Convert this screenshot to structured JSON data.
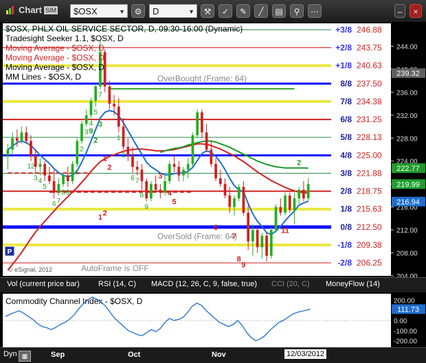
{
  "window": {
    "app_title": "Chart",
    "symbol_value": "$OSX",
    "interval_value": "D",
    "tb_icons": [
      "gear-icon",
      "tools-icon",
      "check-icon",
      "eraser-icon",
      "line-tool-icon",
      "news-icon",
      "pin-icon",
      "more-icon"
    ]
  },
  "chart_data": {
    "type": "candlestick",
    "legend": [
      "$OSX, PHLX OIL SERVICE SECTOR, D, 09:30-16:00 (Dynamic)",
      "Tradesight Seeker 1.1, $OSX, D",
      "Moving Average - $OSX, D",
      "Moving Average - $OSX, D",
      "Moving Average - $OSX, D",
      "MM Lines - $OSX, D"
    ],
    "ylim": [
      204,
      248
    ],
    "y_ticks": [
      204,
      208,
      212,
      216,
      220,
      224,
      228,
      232,
      236,
      240,
      244
    ],
    "x_labels": [
      "Sep",
      "Oct",
      "Nov",
      "12/03/2012"
    ],
    "price_tags": [
      {
        "value": 239.32,
        "label": "239.32",
        "color": "#606060"
      },
      {
        "value": 222.77,
        "label": "222.77",
        "color": "#1f9a2a"
      },
      {
        "value": 219.99,
        "label": "219.99",
        "color": "#1fa030"
      },
      {
        "value": 216.94,
        "label": "216.94",
        "color": "#1e6ed0"
      }
    ],
    "murrey_lines": [
      {
        "label": "+3/8",
        "value": 246.88,
        "color": "#2a8a4a",
        "width": 1,
        "label_color": "#3030ff"
      },
      {
        "label": "+2/8",
        "value": 243.75,
        "color": "#d02020",
        "width": 1,
        "label_color": "#3030ff"
      },
      {
        "label": "+1/8",
        "value": 240.63,
        "color": "#e8e840",
        "width": 4,
        "label_color": "#3030ff"
      },
      {
        "label": "8/8",
        "value": 237.5,
        "color": "#1010ff",
        "width": 3,
        "label_color": "#2020a0"
      },
      {
        "label": "7/8",
        "value": 234.38,
        "color": "#e8e840",
        "width": 4,
        "label_color": "#2020a0"
      },
      {
        "label": "6/8",
        "value": 231.25,
        "color": "#d02020",
        "width": 2,
        "label_color": "#2020a0"
      },
      {
        "label": "5/8",
        "value": 228.13,
        "color": "#2a8a4a",
        "width": 1,
        "label_color": "#2020a0"
      },
      {
        "label": "4/8",
        "value": 225.0,
        "color": "#1010ff",
        "width": 3,
        "label_color": "#2020a0"
      },
      {
        "label": "3/8",
        "value": 221.88,
        "color": "#2a8a4a",
        "width": 1,
        "label_color": "#2020a0"
      },
      {
        "label": "2/8",
        "value": 218.75,
        "color": "#d02020",
        "width": 2,
        "label_color": "#2020a0"
      },
      {
        "label": "1/8",
        "value": 215.63,
        "color": "#e8e840",
        "width": 4,
        "label_color": "#2020a0"
      },
      {
        "label": "0/8",
        "value": 212.5,
        "color": "#1010ff",
        "width": 5,
        "label_color": "#2020a0"
      },
      {
        "label": "-1/8",
        "value": 209.38,
        "color": "#e8e840",
        "width": 4,
        "label_color": "#3030ff"
      },
      {
        "label": "-2/8",
        "value": 206.25,
        "color": "#d02020",
        "width": 1,
        "label_color": "#3030ff"
      }
    ],
    "annotations": [
      {
        "text": "OverBought (Frame: 64)",
        "value": 238.4
      },
      {
        "text": "OverSold (Frame: 64)",
        "value": 210.9
      },
      {
        "text": "AutoFrame is OFF",
        "value": 205.3
      }
    ],
    "copyright": "© eSignal, 2012",
    "candles": [
      {
        "o": 225,
        "h": 227,
        "l": 222.5,
        "c": 226,
        "n": ""
      },
      {
        "o": 226,
        "h": 229,
        "l": 225,
        "c": 228,
        "n": ""
      },
      {
        "o": 228,
        "h": 229.5,
        "l": 226.5,
        "c": 227.5,
        "n": ""
      },
      {
        "o": 227.5,
        "h": 230,
        "l": 227,
        "c": 229,
        "n": ""
      },
      {
        "o": 229,
        "h": 230,
        "l": 227,
        "c": 227.5,
        "n": ""
      },
      {
        "o": 227.5,
        "h": 228.5,
        "l": 224,
        "c": 225,
        "n": "12"
      },
      {
        "o": 225,
        "h": 226,
        "l": 222,
        "c": 223,
        "n": "3"
      },
      {
        "o": 223,
        "h": 224.5,
        "l": 221.5,
        "c": 223.5,
        "n": "4"
      },
      {
        "o": 223.5,
        "h": 224,
        "l": 220.5,
        "c": 221.5,
        "n": "5"
      },
      {
        "o": 221.5,
        "h": 223,
        "l": 220,
        "c": 220.5,
        "n": ""
      },
      {
        "o": 220.5,
        "h": 222.5,
        "l": 217.5,
        "c": 218.5,
        "n": "6"
      },
      {
        "o": 218.5,
        "h": 221,
        "l": 218,
        "c": 220,
        "n": "7"
      },
      {
        "o": 220,
        "h": 222,
        "l": 219.5,
        "c": 221.5,
        "n": "8"
      },
      {
        "o": 221.5,
        "h": 223,
        "l": 219.5,
        "c": 220.5,
        "n": "9"
      },
      {
        "o": 220.5,
        "h": 224,
        "l": 220,
        "c": 223.5,
        "n": ""
      },
      {
        "o": 223.5,
        "h": 228,
        "l": 223,
        "c": 227.5,
        "n": "1"
      },
      {
        "o": 227.5,
        "h": 231,
        "l": 227,
        "c": 230.5,
        "n": "2"
      },
      {
        "o": 230.5,
        "h": 233,
        "l": 230,
        "c": 232,
        "n": "3"
      },
      {
        "o": 232,
        "h": 235,
        "l": 231.5,
        "c": 234.5,
        "n": "4"
      },
      {
        "o": 234.5,
        "h": 237.5,
        "l": 233.5,
        "c": 237,
        "n": "5"
      },
      {
        "o": 237,
        "h": 245,
        "l": 236.5,
        "c": 243,
        "n": "7"
      },
      {
        "o": 243,
        "h": 243.5,
        "l": 236,
        "c": 237,
        "n": ""
      },
      {
        "o": 237,
        "h": 238,
        "l": 233,
        "c": 234,
        "n": ""
      },
      {
        "o": 234,
        "h": 235.5,
        "l": 232,
        "c": 233.5,
        "n": ""
      },
      {
        "o": 233.5,
        "h": 235,
        "l": 229,
        "c": 230,
        "n": "1"
      },
      {
        "o": 230,
        "h": 231.5,
        "l": 226,
        "c": 226.5,
        "n": "2"
      },
      {
        "o": 226.5,
        "h": 228,
        "l": 224,
        "c": 225,
        "n": ""
      },
      {
        "o": 225,
        "h": 226.5,
        "l": 222,
        "c": 223,
        "n": "6"
      },
      {
        "o": 223,
        "h": 224,
        "l": 221.5,
        "c": 222.5,
        "n": "7"
      },
      {
        "o": 222.5,
        "h": 223.5,
        "l": 219,
        "c": 220.5,
        "n": "8"
      },
      {
        "o": 220.5,
        "h": 221,
        "l": 217,
        "c": 217.5,
        "n": "9"
      },
      {
        "o": 217.5,
        "h": 220.5,
        "l": 217,
        "c": 220,
        "n": ""
      },
      {
        "o": 220,
        "h": 221.5,
        "l": 218.5,
        "c": 219,
        "n": ""
      },
      {
        "o": 219,
        "h": 220,
        "l": 217.5,
        "c": 218.5,
        "n": ""
      },
      {
        "o": 218.5,
        "h": 221.5,
        "l": 218,
        "c": 220.5,
        "n": ""
      },
      {
        "o": 220.5,
        "h": 224,
        "l": 220,
        "c": 223.5,
        "n": ""
      },
      {
        "o": 223.5,
        "h": 225,
        "l": 222,
        "c": 223,
        "n": ""
      },
      {
        "o": 223,
        "h": 224,
        "l": 220.5,
        "c": 221.5,
        "n": ""
      },
      {
        "o": 221.5,
        "h": 223,
        "l": 220.5,
        "c": 222.5,
        "n": ""
      },
      {
        "o": 222.5,
        "h": 224.5,
        "l": 221,
        "c": 223.5,
        "n": ""
      },
      {
        "o": 223.5,
        "h": 229,
        "l": 223,
        "c": 228.5,
        "n": ""
      },
      {
        "o": 228.5,
        "h": 233,
        "l": 228,
        "c": 232.5,
        "n": ""
      },
      {
        "o": 232.5,
        "h": 233,
        "l": 228,
        "c": 229,
        "n": ""
      },
      {
        "o": 229,
        "h": 230.5,
        "l": 225.5,
        "c": 226,
        "n": ""
      },
      {
        "o": 226,
        "h": 227.5,
        "l": 223,
        "c": 223.5,
        "n": ""
      },
      {
        "o": 223.5,
        "h": 224.5,
        "l": 220.5,
        "c": 221,
        "n": ""
      },
      {
        "o": 221,
        "h": 222.5,
        "l": 219.5,
        "c": 220,
        "n": ""
      },
      {
        "o": 220,
        "h": 221,
        "l": 217.5,
        "c": 218,
        "n": ""
      },
      {
        "o": 218,
        "h": 219.5,
        "l": 215,
        "c": 216,
        "n": ""
      },
      {
        "o": 216,
        "h": 218,
        "l": 214.5,
        "c": 217.5,
        "n": ""
      },
      {
        "o": 217.5,
        "h": 220,
        "l": 217,
        "c": 219.5,
        "n": ""
      },
      {
        "o": 219.5,
        "h": 220.5,
        "l": 214.5,
        "c": 215,
        "n": ""
      },
      {
        "o": 215,
        "h": 216.5,
        "l": 208.5,
        "c": 210,
        "n": ""
      },
      {
        "o": 210,
        "h": 213,
        "l": 207.5,
        "c": 212,
        "n": ""
      },
      {
        "o": 212,
        "h": 212.5,
        "l": 208,
        "c": 209,
        "n": ""
      },
      {
        "o": 209,
        "h": 211.5,
        "l": 207,
        "c": 211,
        "n": ""
      },
      {
        "o": 211,
        "h": 211.5,
        "l": 206.5,
        "c": 207.5,
        "n": ""
      },
      {
        "o": 207.5,
        "h": 212.5,
        "l": 207,
        "c": 212,
        "n": ""
      },
      {
        "o": 212,
        "h": 216.5,
        "l": 211.5,
        "c": 216,
        "n": ""
      },
      {
        "o": 216,
        "h": 217.5,
        "l": 214.5,
        "c": 215,
        "n": ""
      },
      {
        "o": 215,
        "h": 218.5,
        "l": 214.5,
        "c": 218,
        "n": ""
      },
      {
        "o": 218,
        "h": 218.5,
        "l": 215,
        "c": 215.5,
        "n": ""
      },
      {
        "o": 215.5,
        "h": 218.5,
        "l": 213,
        "c": 217.5,
        "n": ""
      },
      {
        "o": 217.5,
        "h": 219.5,
        "l": 216.5,
        "c": 219,
        "n": ""
      },
      {
        "o": 219,
        "h": 220.5,
        "l": 217,
        "c": 217.5,
        "n": ""
      },
      {
        "o": 217.5,
        "h": 221,
        "l": 217,
        "c": 220,
        "n": ""
      }
    ],
    "blue_ma": [
      226,
      226.6,
      227.2,
      227.5,
      227.2,
      226.7,
      225.9,
      225,
      224.3,
      223.6,
      222.7,
      222,
      221.5,
      221.3,
      221.5,
      222.3,
      223.8,
      225.5,
      227.5,
      229.5,
      231.5,
      232.5,
      232.8,
      232.6,
      231.9,
      230.7,
      229.3,
      227.9,
      226.5,
      225.2,
      223.8,
      223,
      222.5,
      221.9,
      221.6,
      221.6,
      221.8,
      221.9,
      222,
      222.2,
      222.9,
      224.1,
      225.3,
      225.8,
      225.5,
      224.8,
      223.8,
      222.5,
      221,
      219.7,
      219,
      218.6,
      216.6,
      214.8,
      213.5,
      212.6,
      211.5,
      211.2,
      211.8,
      212.6,
      213.6,
      214.5,
      215.3,
      216.3,
      216.7,
      217
    ],
    "red_ma": [
      205,
      206,
      207,
      208.1,
      209.3,
      210.5,
      211.6,
      212.6,
      213.5,
      214.4,
      215.3,
      216.2,
      217,
      217.8,
      218.6,
      219.4,
      220.3,
      221.2,
      222.2,
      223.1,
      223.9,
      224.4,
      224.8,
      225.1,
      225.4,
      225.7,
      225.9,
      226,
      226.1,
      226.1,
      226,
      225.9,
      225.8,
      225.8,
      225.8,
      225.9,
      226,
      226.2,
      226.4,
      226.6,
      226.8,
      227,
      227,
      226.9,
      226.7,
      226.4,
      226.1,
      225.7,
      225.3,
      224.9,
      224.4,
      223.9,
      223.3,
      222.7,
      222.1,
      221.6,
      221.1,
      220.6,
      220.2,
      219.8,
      219.4,
      219.1,
      218.8,
      218.6,
      218.5,
      218.4
    ],
    "green_ma_start": 33,
    "green_ma": [
      225.5,
      225.8,
      226,
      226.2,
      226.3,
      226.5,
      226.8,
      227,
      227.2,
      227.4,
      227.5,
      227.5,
      227.3,
      227,
      226.7,
      226.4,
      226,
      225.6,
      225.2,
      224.8,
      224.4,
      224,
      223.7,
      223.4,
      223.2,
      223,
      222.9,
      222.8,
      222.8,
      222.8,
      222.8,
      222.8,
      222.77
    ],
    "green_seg": {
      "from": 22,
      "to": 62,
      "value": 236.6
    },
    "red_dash": [
      {
        "from": 0,
        "to": 18,
        "value": 221.9
      },
      {
        "from": 9,
        "to": 40,
        "value": 218.6
      }
    ],
    "numbers": [
      {
        "t": "9",
        "i": 18,
        "v": 228.8,
        "c": "#20a020"
      },
      {
        "t": "2",
        "i": 19,
        "v": 227.2,
        "c": "#20a020"
      },
      {
        "t": "3",
        "i": 20,
        "v": 230.0,
        "c": "#20a020"
      },
      {
        "t": "1",
        "i": 21,
        "v": 224.0,
        "c": "#d02020"
      },
      {
        "t": "2",
        "i": 22,
        "v": 222.5,
        "c": "#d02020"
      },
      {
        "t": "1",
        "i": 20,
        "v": 213.8,
        "c": "#d02020"
      },
      {
        "t": "2",
        "i": 21,
        "v": 214.5,
        "c": "#d02020"
      },
      {
        "t": "3",
        "i": 33,
        "v": 221.0,
        "c": "#d02020"
      },
      {
        "t": "4",
        "i": 35,
        "v": 218.0,
        "c": "#d02020"
      },
      {
        "t": "5",
        "i": 36,
        "v": 216.5,
        "c": "#d02020"
      },
      {
        "t": "6",
        "i": 45,
        "v": 212.0,
        "c": "#d02020"
      },
      {
        "t": "7",
        "i": 49,
        "v": 210.5,
        "c": "#d02020"
      },
      {
        "t": "8",
        "i": 50,
        "v": 206.5,
        "c": "#d02020"
      },
      {
        "t": "9",
        "i": 51,
        "v": 205.5,
        "c": "#d02020"
      },
      {
        "t": "11",
        "i": 60,
        "v": 211.5,
        "c": "#d02020"
      },
      {
        "t": "2",
        "i": 63,
        "v": 223.3,
        "c": "#20a020"
      }
    ]
  },
  "indicator_tabs": [
    "Vol (current price bar)",
    "RSI (14, C)",
    "MACD (12, 26, C, 9, false, true)",
    "CCI (20, C)",
    "MoneyFlow (14)"
  ],
  "cci": {
    "title": "Commodity Channel Index - $OSX, D",
    "last_label": "111.73",
    "ylim": [
      -250,
      250
    ],
    "y_ticks": [
      200,
      100,
      0,
      -100,
      -200
    ],
    "y_tick_labels": [
      "200.00",
      "100.00",
      "0.00",
      "-100.00",
      "-200.00"
    ],
    "values": [
      40,
      60,
      80,
      95,
      70,
      40,
      10,
      -30,
      -60,
      -70,
      -90,
      -70,
      -40,
      -20,
      10,
      50,
      110,
      160,
      200,
      230,
      210,
      180,
      140,
      80,
      20,
      -20,
      -60,
      -100,
      -120,
      -140,
      -150,
      -120,
      -90,
      -110,
      -80,
      -20,
      20,
      0,
      10,
      30,
      80,
      140,
      170,
      150,
      100,
      60,
      20,
      -20,
      -40,
      -60,
      -40,
      0,
      -50,
      -120,
      -170,
      -200,
      -180,
      -150,
      -100,
      -60,
      -20,
      0,
      30,
      60,
      80,
      90,
      100,
      111.73
    ]
  },
  "statusbar": {
    "mode": "Dyn",
    "date_label": "12/03/2012"
  }
}
